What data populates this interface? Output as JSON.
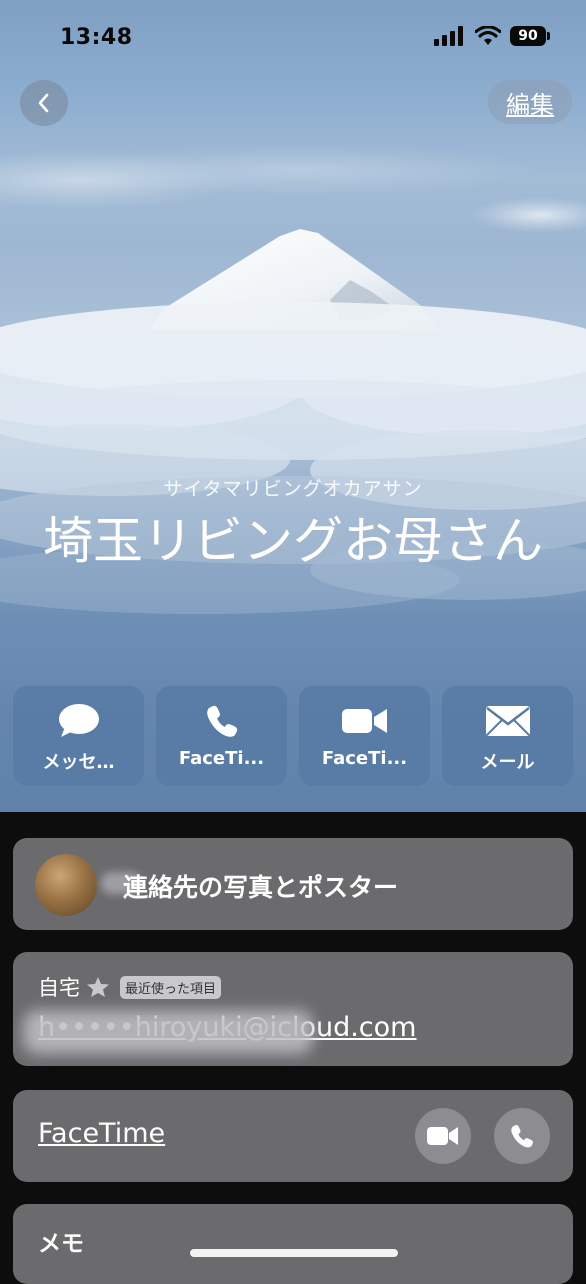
{
  "status_bar": {
    "time": "13:48",
    "battery": "90"
  },
  "header": {
    "edit_label": "編集"
  },
  "contact": {
    "phonetic_name": "サイタマリビングオカアサン",
    "name": "埼玉リビングお母さん"
  },
  "actions": [
    {
      "label": "メッセ…",
      "icon": "message-bubble-icon"
    },
    {
      "label": "FaceTi...",
      "icon": "phone-icon"
    },
    {
      "label": "FaceTi...",
      "icon": "video-camera-icon"
    },
    {
      "label": "メール",
      "icon": "envelope-icon"
    }
  ],
  "photo_card": {
    "label": "連絡先の写真とポスター"
  },
  "email_card": {
    "label": "自宅",
    "badge": "最近使った項目",
    "value": "h•••••hiroyuki@icloud.com"
  },
  "facetime_card": {
    "label": "FaceTime"
  },
  "memo_card": {
    "label": "メモ"
  },
  "colors": {
    "action_bg": "#587ca5",
    "card_bg": "#6b6b6e",
    "page_bg": "#0d0d0e"
  }
}
